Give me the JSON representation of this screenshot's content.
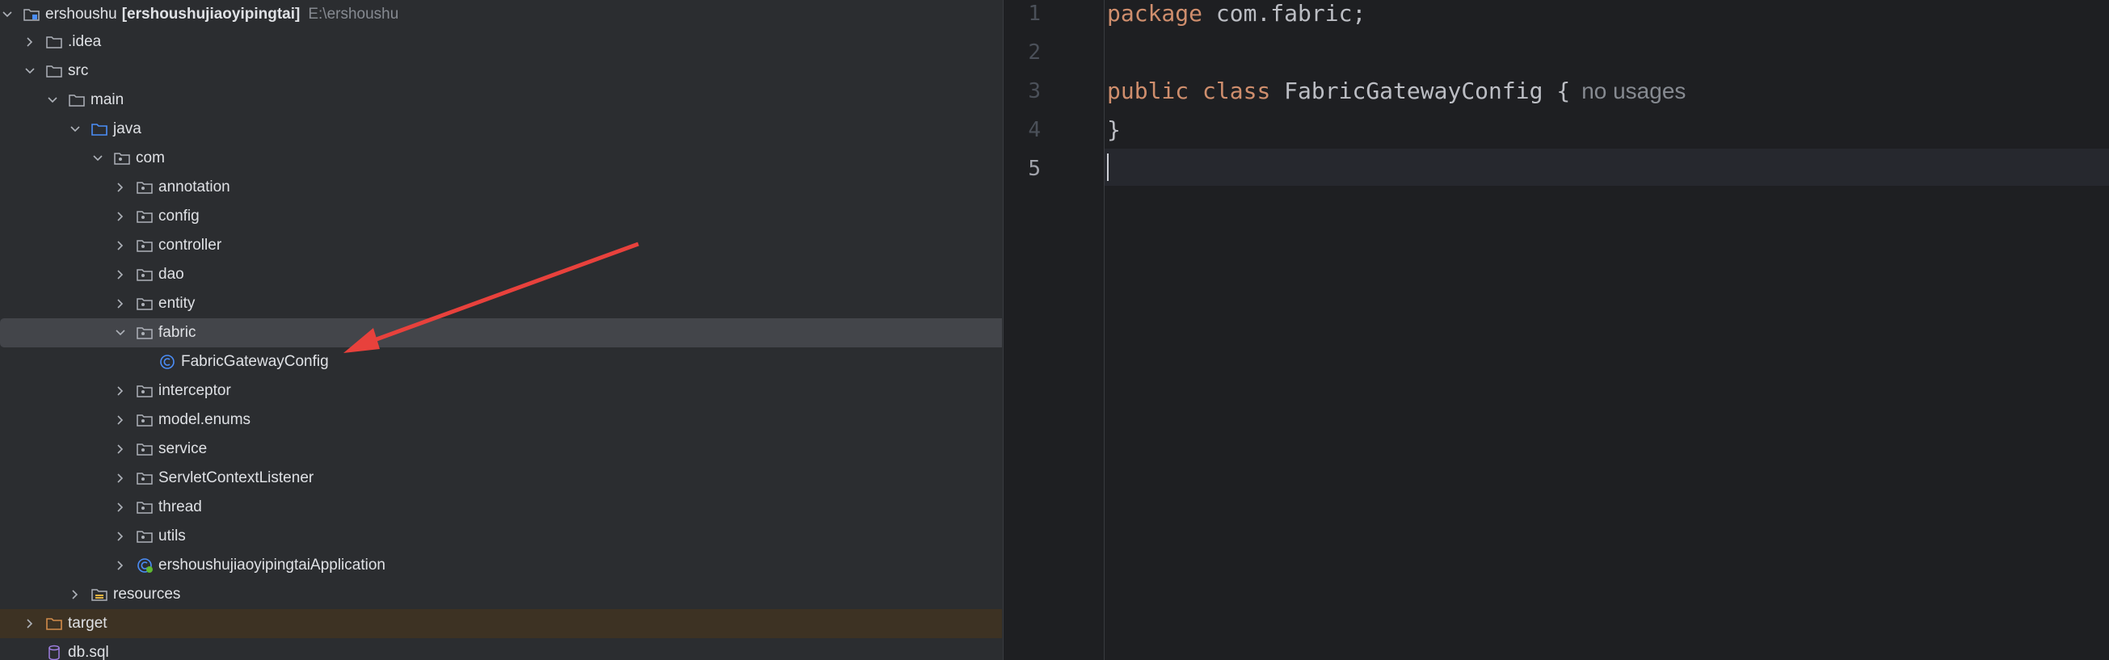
{
  "project_tree": {
    "root": {
      "name": "ershoushu",
      "module": "[ershoushujiaoyipingtai]",
      "path": "E:\\ershoushu"
    },
    "items": [
      {
        "label": "ershoushu",
        "depth": 0
      },
      {
        "label": ".idea",
        "depth": 1
      },
      {
        "label": "src",
        "depth": 1
      },
      {
        "label": "main",
        "depth": 2
      },
      {
        "label": "java",
        "depth": 3
      },
      {
        "label": "com",
        "depth": 4
      },
      {
        "label": "annotation",
        "depth": 5
      },
      {
        "label": "config",
        "depth": 5
      },
      {
        "label": "controller",
        "depth": 5
      },
      {
        "label": "dao",
        "depth": 5
      },
      {
        "label": "entity",
        "depth": 5
      },
      {
        "label": "fabric",
        "depth": 5
      },
      {
        "label": "FabricGatewayConfig",
        "depth": 6
      },
      {
        "label": "interceptor",
        "depth": 5
      },
      {
        "label": "model.enums",
        "depth": 5
      },
      {
        "label": "service",
        "depth": 5
      },
      {
        "label": "ServletContextListener",
        "depth": 5
      },
      {
        "label": "thread",
        "depth": 5
      },
      {
        "label": "utils",
        "depth": 5
      },
      {
        "label": "ershoushujiaoyipingtaiApplication",
        "depth": 5
      },
      {
        "label": "resources",
        "depth": 3
      },
      {
        "label": "target",
        "depth": 1
      },
      {
        "label": "db.sql",
        "depth": 1
      }
    ]
  },
  "editor": {
    "line_numbers": [
      "1",
      "2",
      "3",
      "4",
      "5"
    ],
    "line1": {
      "keyword": "package",
      "rest": " com.fabric;"
    },
    "line3": {
      "kw1": "public",
      "kw2": "class",
      "class_name": "FabricGatewayConfig",
      "brace": "{",
      "hint": "no usages"
    },
    "line4": "}"
  },
  "colors": {
    "annotation_arrow": "#e8413c",
    "keyword": "#cf8e6d",
    "package_folder": "#4b8ef8"
  }
}
